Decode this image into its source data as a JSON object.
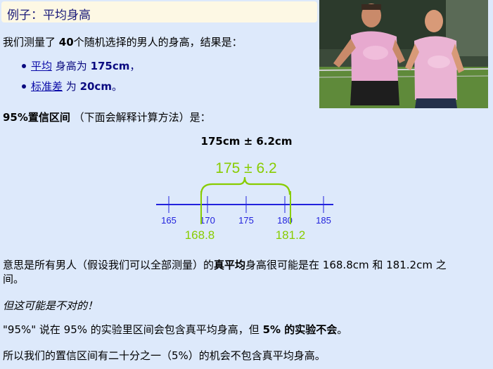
{
  "title": "例子：平均身高",
  "intro": {
    "prefix": "我们测量了 ",
    "count": "40",
    "suffix": "个随机选择的男人的身高，结果是："
  },
  "bullets": [
    {
      "link": "平均",
      "text": " 身高为 ",
      "value": "175cm",
      "end": "，"
    },
    {
      "link": "标准差",
      "text": " 为 ",
      "value": "20cm",
      "end": "。"
    }
  ],
  "ci_heading": {
    "bold": "95%置信区间",
    "rest": " （下面会解释计算方法）是："
  },
  "ci_formula": "175cm ± 6.2cm",
  "diagram": {
    "label": "175 ± 6.2",
    "ticks": [
      "165",
      "170",
      "175",
      "180",
      "185"
    ],
    "lower": "168.8",
    "upper": "181.2",
    "colors": {
      "axis": "#2222dd",
      "interval": "#88cc00",
      "tick_text": "#2222dd"
    }
  },
  "para1": {
    "a": "意思是所有男人（假设我们可以全部测量）的",
    "bold": "真平均",
    "b": "身高很可能是在 168.8cm 和 181.2cm 之",
    "line2": "间。"
  },
  "para2": "但这可能是不对的！",
  "para3": {
    "a": "\"95%\" 说在 95% 的实验里区间会包含真平均身高，但 ",
    "bold": "5% 的实验不会",
    "end": "。"
  },
  "para4": "所以我们的置信区间有二十分之一（5%）的机会不包含真平均身高。",
  "photo_icon": "runners-photo"
}
